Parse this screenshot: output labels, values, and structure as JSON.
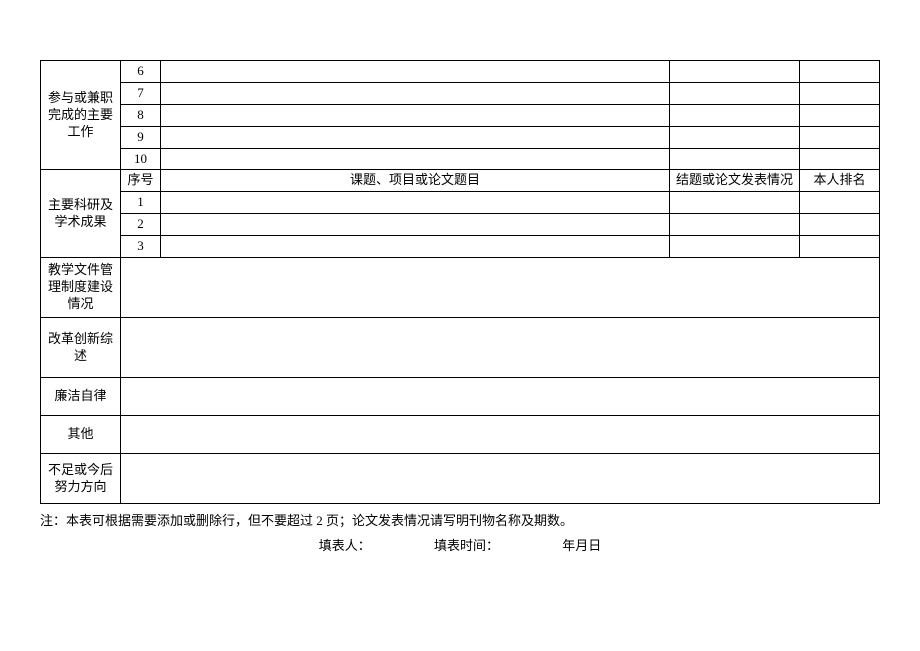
{
  "section1": {
    "label": "参与或兼职完成的主要工作",
    "rows": [
      "6",
      "7",
      "8",
      "9",
      "10"
    ]
  },
  "section2": {
    "label": "主要科研及学术成果",
    "header": {
      "num": "序号",
      "topic": "课题、项目或论文题目",
      "status": "结题或论文发表情况",
      "rank": "本人排名"
    },
    "rows": [
      "1",
      "2",
      "3"
    ]
  },
  "section3": {
    "label": "教学文件管理制度建设情况"
  },
  "section4": {
    "label": "改革创新综述"
  },
  "section5": {
    "label": "廉洁自律"
  },
  "section6": {
    "label": "其他"
  },
  "section7": {
    "label": "不足或今后努力方向"
  },
  "notes": "注：本表可根据需要添加或删除行，但不要超过 2 页；论文发表情况请写明刊物名称及期数。",
  "footer": {
    "filler": "填表人：",
    "time": "填表时间：",
    "date": "年月日"
  }
}
